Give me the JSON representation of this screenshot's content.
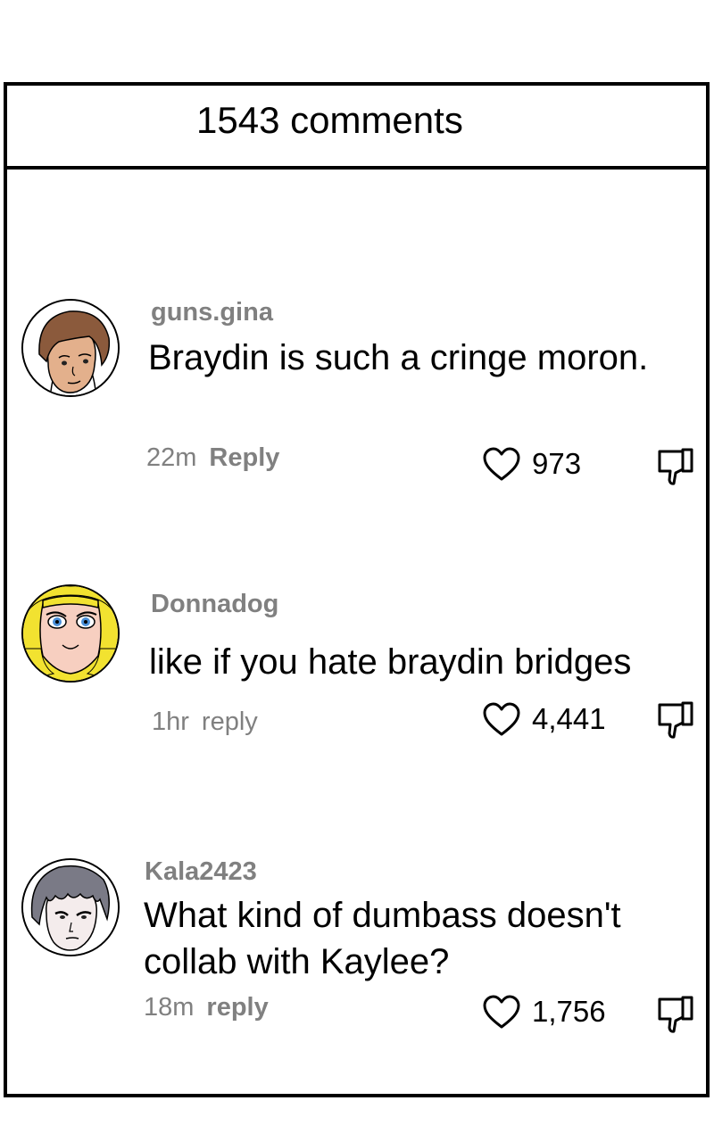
{
  "header": {
    "title": "1543 comments"
  },
  "comments": [
    {
      "username": "guns.gina",
      "text": "Braydin is such a cringe moron.",
      "time": "22m",
      "reply_label": "Reply",
      "likes": "973",
      "avatar_icon": "brown-haired-boy-avatar"
    },
    {
      "username": "Donnadog",
      "text": "like if you hate braydin bridges",
      "time": "1hr",
      "reply_label": "reply",
      "likes": "4,441",
      "avatar_icon": "blonde-girl-avatar"
    },
    {
      "username": "Kala2423",
      "text": "What kind of dumbass doesn't collab with Kaylee?",
      "time": "18m",
      "reply_label": "reply",
      "likes": "1,756",
      "avatar_icon": "gray-haired-boy-avatar"
    }
  ],
  "icons": {
    "like": "heart-icon",
    "dislike": "thumbs-down-icon"
  }
}
